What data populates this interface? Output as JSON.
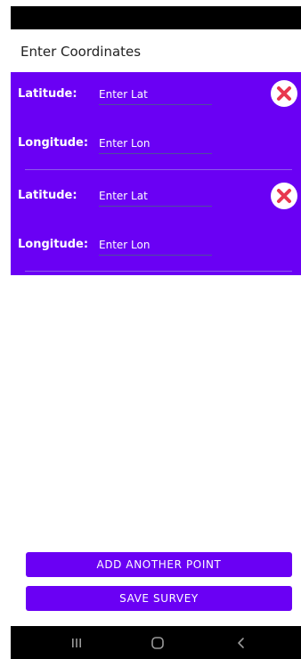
{
  "title": "Enter Coordinates",
  "points": [
    {
      "latitude_label": "Latitude:",
      "latitude_placeholder": "Enter Lat",
      "longitude_label": "Longitude:",
      "longitude_placeholder": "Enter Lon"
    },
    {
      "latitude_label": "Latitude:",
      "latitude_placeholder": "Enter Lat",
      "longitude_label": "Longitude:",
      "longitude_placeholder": "Enter Lon"
    }
  ],
  "buttons": {
    "add_point": "ADD ANOTHER POINT",
    "save_survey": "SAVE SURVEY"
  },
  "icons": {
    "delete": "close-circle-icon",
    "nav_recent": "recent-apps-icon",
    "nav_home": "home-icon",
    "nav_back": "back-icon"
  },
  "colors": {
    "accent": "#6a00f4",
    "delete": "#e8384f"
  }
}
